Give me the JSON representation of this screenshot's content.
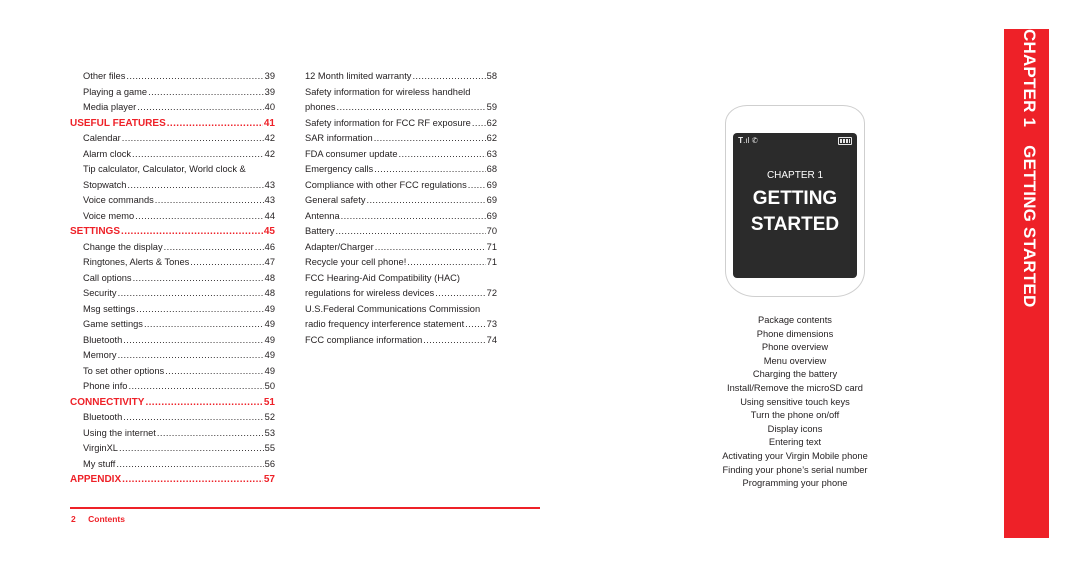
{
  "left_column": [
    {
      "type": "sub",
      "title": "Other files",
      "page": "39"
    },
    {
      "type": "sub",
      "title": "Playing a game",
      "page": "39"
    },
    {
      "type": "sub",
      "title": "Media player",
      "page": "40"
    },
    {
      "type": "sec",
      "title": "USEFUL FEATURES",
      "page": "41"
    },
    {
      "type": "sub",
      "title": "Calendar",
      "page": "42"
    },
    {
      "type": "sub",
      "title": "Alarm clock",
      "page": "42"
    },
    {
      "type": "wrap",
      "title": "Tip calculator, Calculator, World clock &"
    },
    {
      "type": "sub",
      "title": "Stopwatch",
      "page": "43"
    },
    {
      "type": "sub",
      "title": "Voice commands",
      "page": "43"
    },
    {
      "type": "sub",
      "title": "Voice memo",
      "page": "44"
    },
    {
      "type": "sec",
      "title": "SETTINGS",
      "page": "45"
    },
    {
      "type": "sub",
      "title": "Change the display",
      "page": "46"
    },
    {
      "type": "sub",
      "title": "Ringtones, Alerts & Tones",
      "page": "47"
    },
    {
      "type": "sub",
      "title": "Call options",
      "page": "48"
    },
    {
      "type": "sub",
      "title": "Security",
      "page": "48"
    },
    {
      "type": "sub",
      "title": "Msg settings",
      "page": "49"
    },
    {
      "type": "sub",
      "title": "Game settings",
      "page": "49"
    },
    {
      "type": "sub",
      "title": "Bluetooth",
      "page": "49"
    },
    {
      "type": "sub",
      "title": "Memory",
      "page": "49"
    },
    {
      "type": "sub",
      "title": "To set other options",
      "page": "49"
    },
    {
      "type": "sub",
      "title": "Phone info",
      "page": "50"
    },
    {
      "type": "sec",
      "title": "CONNECTIVITY",
      "page": "51"
    },
    {
      "type": "sub",
      "title": "Bluetooth",
      "page": "52"
    },
    {
      "type": "sub",
      "title": "Using the internet",
      "page": "53"
    },
    {
      "type": "sub",
      "title": "VirginXL",
      "page": "55"
    },
    {
      "type": "sub",
      "title": "My stuff",
      "page": "56"
    },
    {
      "type": "sec",
      "title": "APPENDIX",
      "page": "57"
    }
  ],
  "mid_column": [
    {
      "type": "sub",
      "title": "12 Month limited warranty",
      "page": "58"
    },
    {
      "type": "wrap",
      "title": "Safety information for wireless handheld"
    },
    {
      "type": "sub",
      "title": "phones",
      "page": "59"
    },
    {
      "type": "sub",
      "title": "Safety information for FCC RF exposure",
      "page": "62"
    },
    {
      "type": "sub",
      "title": "SAR information",
      "page": "62"
    },
    {
      "type": "sub",
      "title": "FDA consumer update",
      "page": "63"
    },
    {
      "type": "sub",
      "title": "Emergency calls",
      "page": "68"
    },
    {
      "type": "sub",
      "title": "Compliance with other FCC regulations",
      "page": "69"
    },
    {
      "type": "sub",
      "title": "General safety",
      "page": "69"
    },
    {
      "type": "sub",
      "title": "Antenna",
      "page": "69"
    },
    {
      "type": "sub",
      "title": "Battery",
      "page": "70"
    },
    {
      "type": "sub",
      "title": "Adapter/Charger",
      "page": "71"
    },
    {
      "type": "sub",
      "title": "Recycle your cell phone!",
      "page": "71"
    },
    {
      "type": "wrap",
      "title": "FCC Hearing-Aid Compatibility (HAC)"
    },
    {
      "type": "sub",
      "title": "regulations for wireless devices",
      "page": "72"
    },
    {
      "type": "wrap",
      "title": "U.S.Federal Communications Commission"
    },
    {
      "type": "sub",
      "title": "radio frequency interference statement",
      "page": "73"
    },
    {
      "type": "sub",
      "title": "FCC compliance information",
      "page": "74"
    }
  ],
  "footer": {
    "page_number": "2",
    "label": "Contents"
  },
  "phone_screen": {
    "status_icons": "signal-icon, bluetooth-icon, battery-icon",
    "chapter": "CHAPTER 1",
    "title_line1": "GETTING",
    "title_line2": "STARTED"
  },
  "chapter_topics": [
    "Package contents",
    "Phone dimensions",
    "Phone overview",
    "Menu overview",
    "Charging the battery",
    "Install/Remove the microSD card",
    "Using sensitive touch keys",
    "Turn the phone on/off",
    "Display icons",
    "Entering text",
    "Activating your Virgin Mobile phone",
    "Finding your phone’s serial number",
    "Programming your phone"
  ],
  "side_tab": {
    "chapter": "CHAPTER 1",
    "title": "GETTING STARTED"
  },
  "colors": {
    "accent": "#ee2128",
    "screen": "#2b2b2b",
    "text": "#231f20"
  }
}
